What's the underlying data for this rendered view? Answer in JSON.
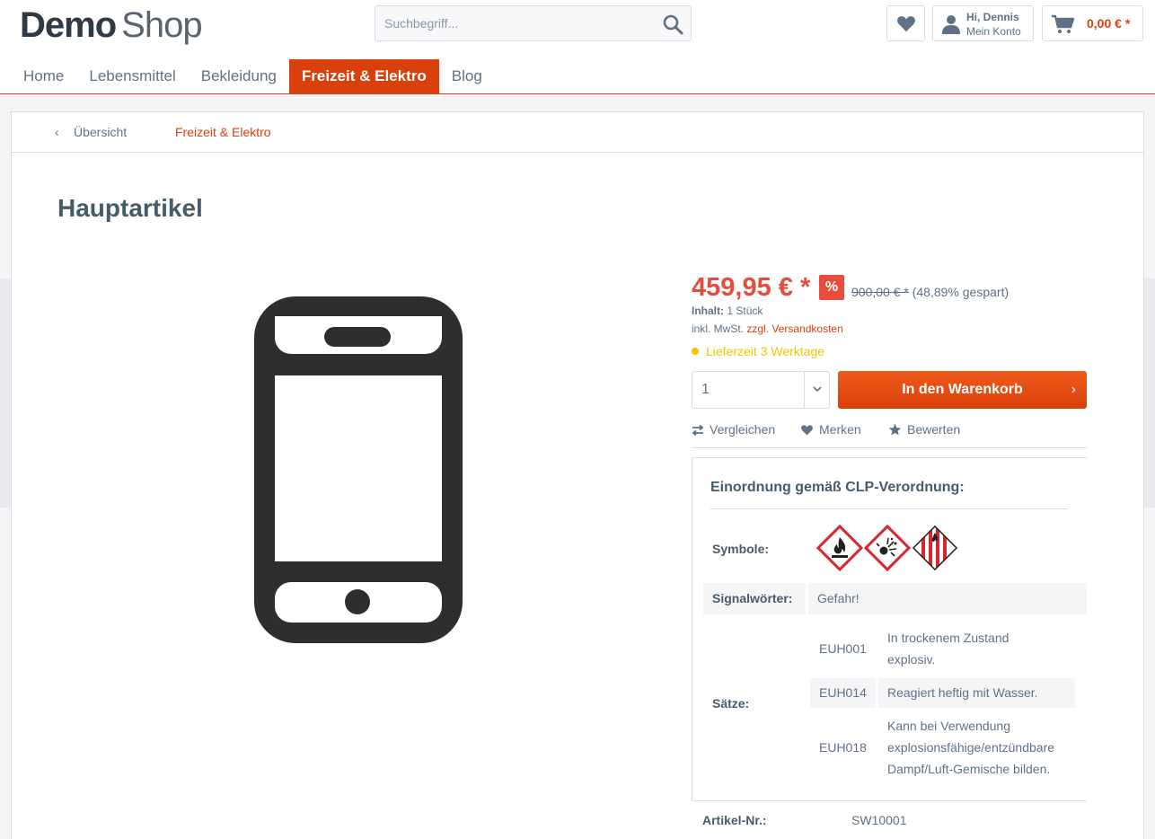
{
  "logo": {
    "part1": "Demo",
    "part2": "Shop"
  },
  "search": {
    "placeholder": "Suchbegriff..."
  },
  "account": {
    "greeting": "Hi, Dennis",
    "label": "Mein Konto"
  },
  "cart": {
    "amount": "0,00 € *"
  },
  "nav": {
    "items": [
      {
        "label": "Home"
      },
      {
        "label": "Lebensmittel"
      },
      {
        "label": "Bekleidung"
      },
      {
        "label": "Freizeit & Elektro"
      },
      {
        "label": "Blog"
      }
    ]
  },
  "breadcrumb": {
    "back": "Übersicht",
    "category": "Freizeit & Elektro"
  },
  "product": {
    "title": "Hauptartikel",
    "price": "459,95 € *",
    "discount_badge": "%",
    "old_price": "900,00 € *",
    "saved": "(48,89% gespart)",
    "content_label": "Inhalt:",
    "content_value": "1 Stück",
    "tax_text": "inkl. MwSt.",
    "shipping_link": "zzgl. Versandkosten",
    "delivery": "Lieferzeit 3 Werktage",
    "quantity": "1",
    "add_to_cart": "In den Warenkorb",
    "actions": {
      "compare": "Vergleichen",
      "remember": "Merken",
      "rate": "Bewerten"
    },
    "article_nr_label": "Artikel-Nr.:",
    "article_nr": "SW10001"
  },
  "clp": {
    "title": "Einordnung gemäß CLP-Verordnung:",
    "symbols_label": "Symbole:",
    "symbols": [
      "flame-pictogram",
      "exploding-bomb-pictogram",
      "flammable-solid-pictogram"
    ],
    "signal_label": "Signalwörter:",
    "signal_value": "Gefahr!",
    "statements_label": "Sätze:",
    "statements": [
      {
        "code": "EUH001",
        "line1": "In trockenem Zustand",
        "line2": "explosiv."
      },
      {
        "code": "EUH014",
        "line1": "Reagiert heftig mit Wasser."
      },
      {
        "code": "EUH018",
        "line1": "Kann bei Verwendung",
        "line2": "explosionsfähige/entzündbare",
        "line3": "Dampf/Luft-Gemische bilden."
      }
    ]
  },
  "colors": {
    "accent": "#d9400b",
    "price": "#e74c3c",
    "delivery": "#f2c500"
  }
}
